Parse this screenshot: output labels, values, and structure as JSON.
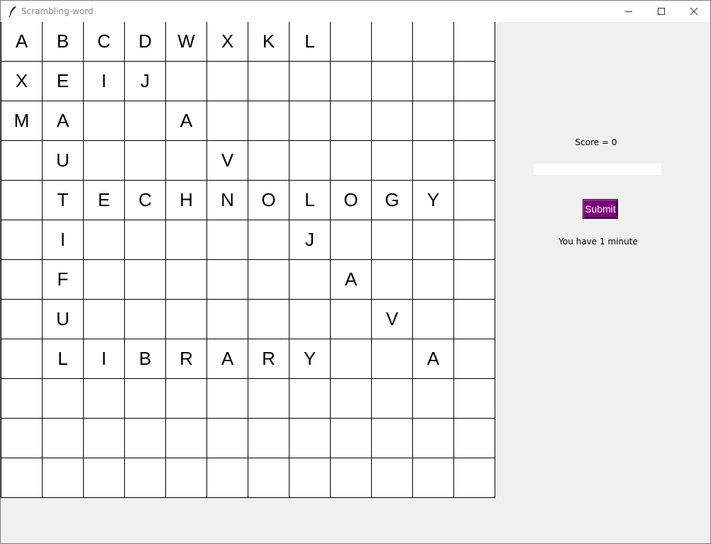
{
  "window": {
    "title": "Scrambling-word"
  },
  "grid": {
    "rows": [
      [
        "A",
        "B",
        "C",
        "D",
        "W",
        "X",
        "K",
        "L",
        "",
        "",
        "",
        ""
      ],
      [
        "X",
        "E",
        "I",
        "J",
        "",
        "",
        "",
        "",
        "",
        "",
        "",
        ""
      ],
      [
        "M",
        "A",
        "",
        "",
        "A",
        "",
        "",
        "",
        "",
        "",
        "",
        ""
      ],
      [
        "",
        "U",
        "",
        "",
        "",
        "V",
        "",
        "",
        "",
        "",
        "",
        ""
      ],
      [
        "",
        "T",
        "E",
        "C",
        "H",
        "N",
        "O",
        "L",
        "O",
        "G",
        "Y",
        ""
      ],
      [
        "",
        "I",
        "",
        "",
        "",
        "",
        "",
        "J",
        "",
        "",
        "",
        ""
      ],
      [
        "",
        "F",
        "",
        "",
        "",
        "",
        "",
        "",
        "A",
        "",
        "",
        ""
      ],
      [
        "",
        "U",
        "",
        "",
        "",
        "",
        "",
        "",
        "",
        "V",
        "",
        ""
      ],
      [
        "",
        "L",
        "I",
        "B",
        "R",
        "A",
        "R",
        "Y",
        "",
        "",
        "A",
        ""
      ],
      [
        "",
        "",
        "",
        "",
        "",
        "",
        "",
        "",
        "",
        "",
        "",
        ""
      ],
      [
        "",
        "",
        "",
        "",
        "",
        "",
        "",
        "",
        "",
        "",
        "",
        ""
      ],
      [
        "",
        "",
        "",
        "",
        "",
        "",
        "",
        "",
        "",
        "",
        "",
        ""
      ]
    ]
  },
  "panel": {
    "score_label": "Score = 0",
    "answer_value": "",
    "submit_label": "Submit",
    "timer_label": "You have 1 minute",
    "submit_color": "#800080"
  }
}
